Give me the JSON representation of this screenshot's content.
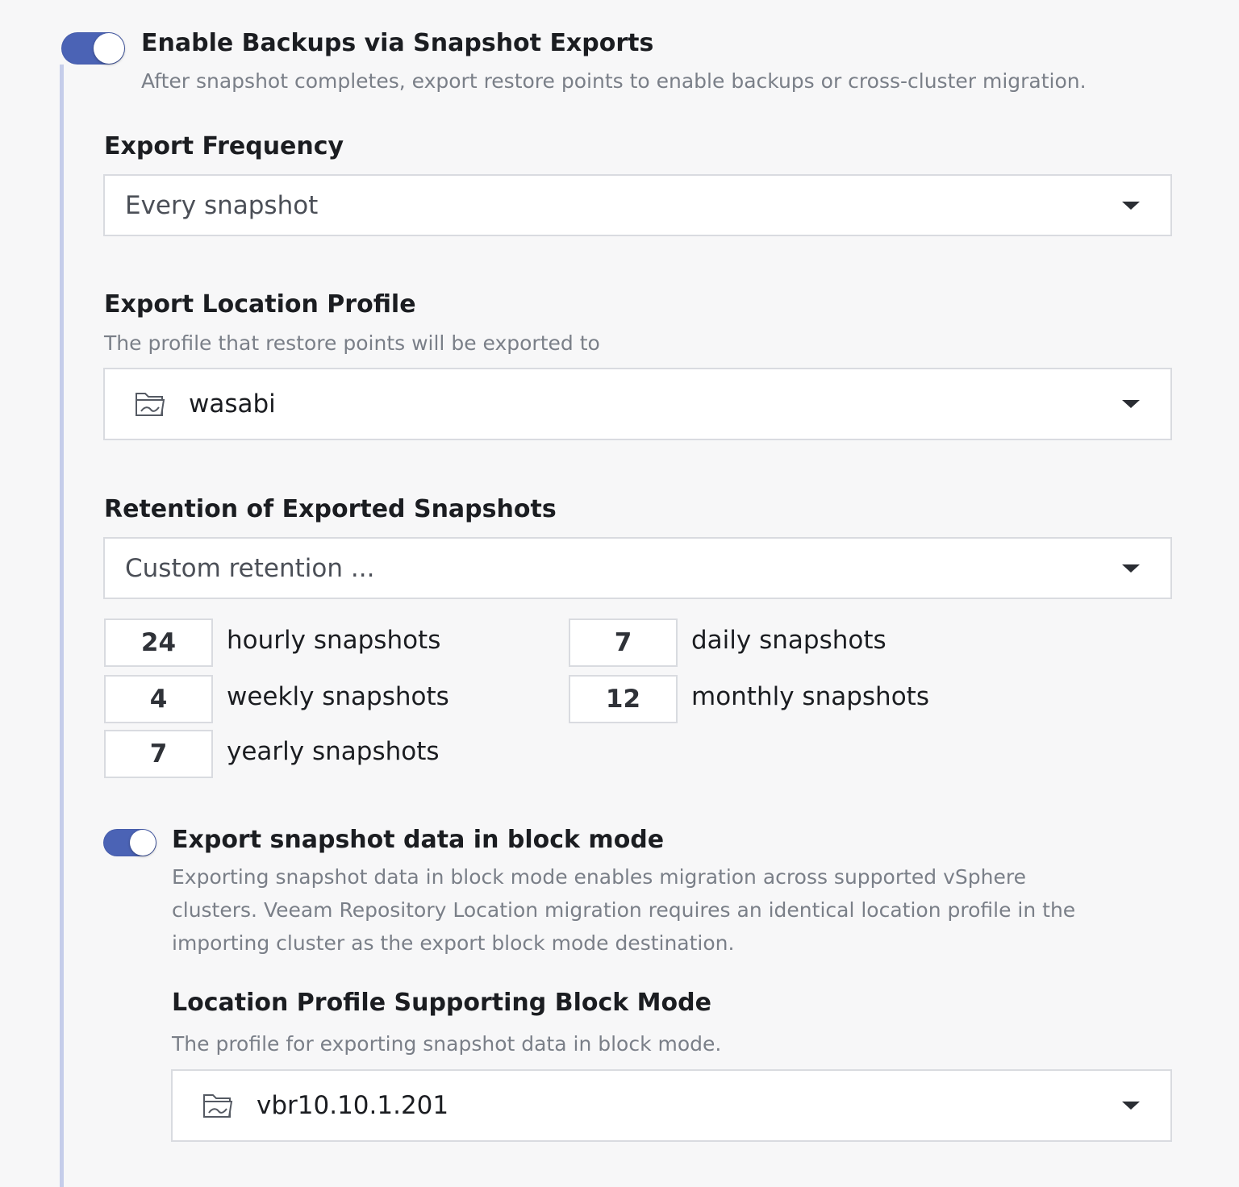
{
  "enable_backups": {
    "toggle_state": "on",
    "title": "Enable Backups via Snapshot Exports",
    "description": "After snapshot completes, export restore points to enable backups or cross-cluster migration."
  },
  "export_frequency": {
    "label": "Export Frequency",
    "value": "Every snapshot"
  },
  "export_location": {
    "label": "Export Location Profile",
    "description": "The profile that restore points will be exported to",
    "value": "wasabi",
    "icon": "folder-icon"
  },
  "retention": {
    "label": "Retention of Exported Snapshots",
    "value": "Custom retention ...",
    "hourly": {
      "count": "24",
      "label": "hourly snapshots"
    },
    "daily": {
      "count": "7",
      "label": "daily snapshots"
    },
    "weekly": {
      "count": "4",
      "label": "weekly snapshots"
    },
    "monthly": {
      "count": "12",
      "label": "monthly snapshots"
    },
    "yearly": {
      "count": "7",
      "label": "yearly snapshots"
    }
  },
  "block_mode": {
    "toggle_state": "on",
    "title": "Export snapshot data in block mode",
    "description_lines": [
      "Exporting snapshot data in block mode enables migration across supported vSphere",
      "clusters. Veeam Repository Location migration requires an identical location profile in the",
      "importing cluster as the export block mode destination."
    ]
  },
  "block_profile": {
    "label": "Location Profile Supporting Block Mode",
    "description": "The profile for exporting snapshot data in block mode.",
    "value": "vbr10.10.1.201",
    "icon": "folder-icon"
  },
  "colors": {
    "accent": "#4b63b5",
    "rail": "#c5cdea",
    "background": "#f7f7f8"
  }
}
